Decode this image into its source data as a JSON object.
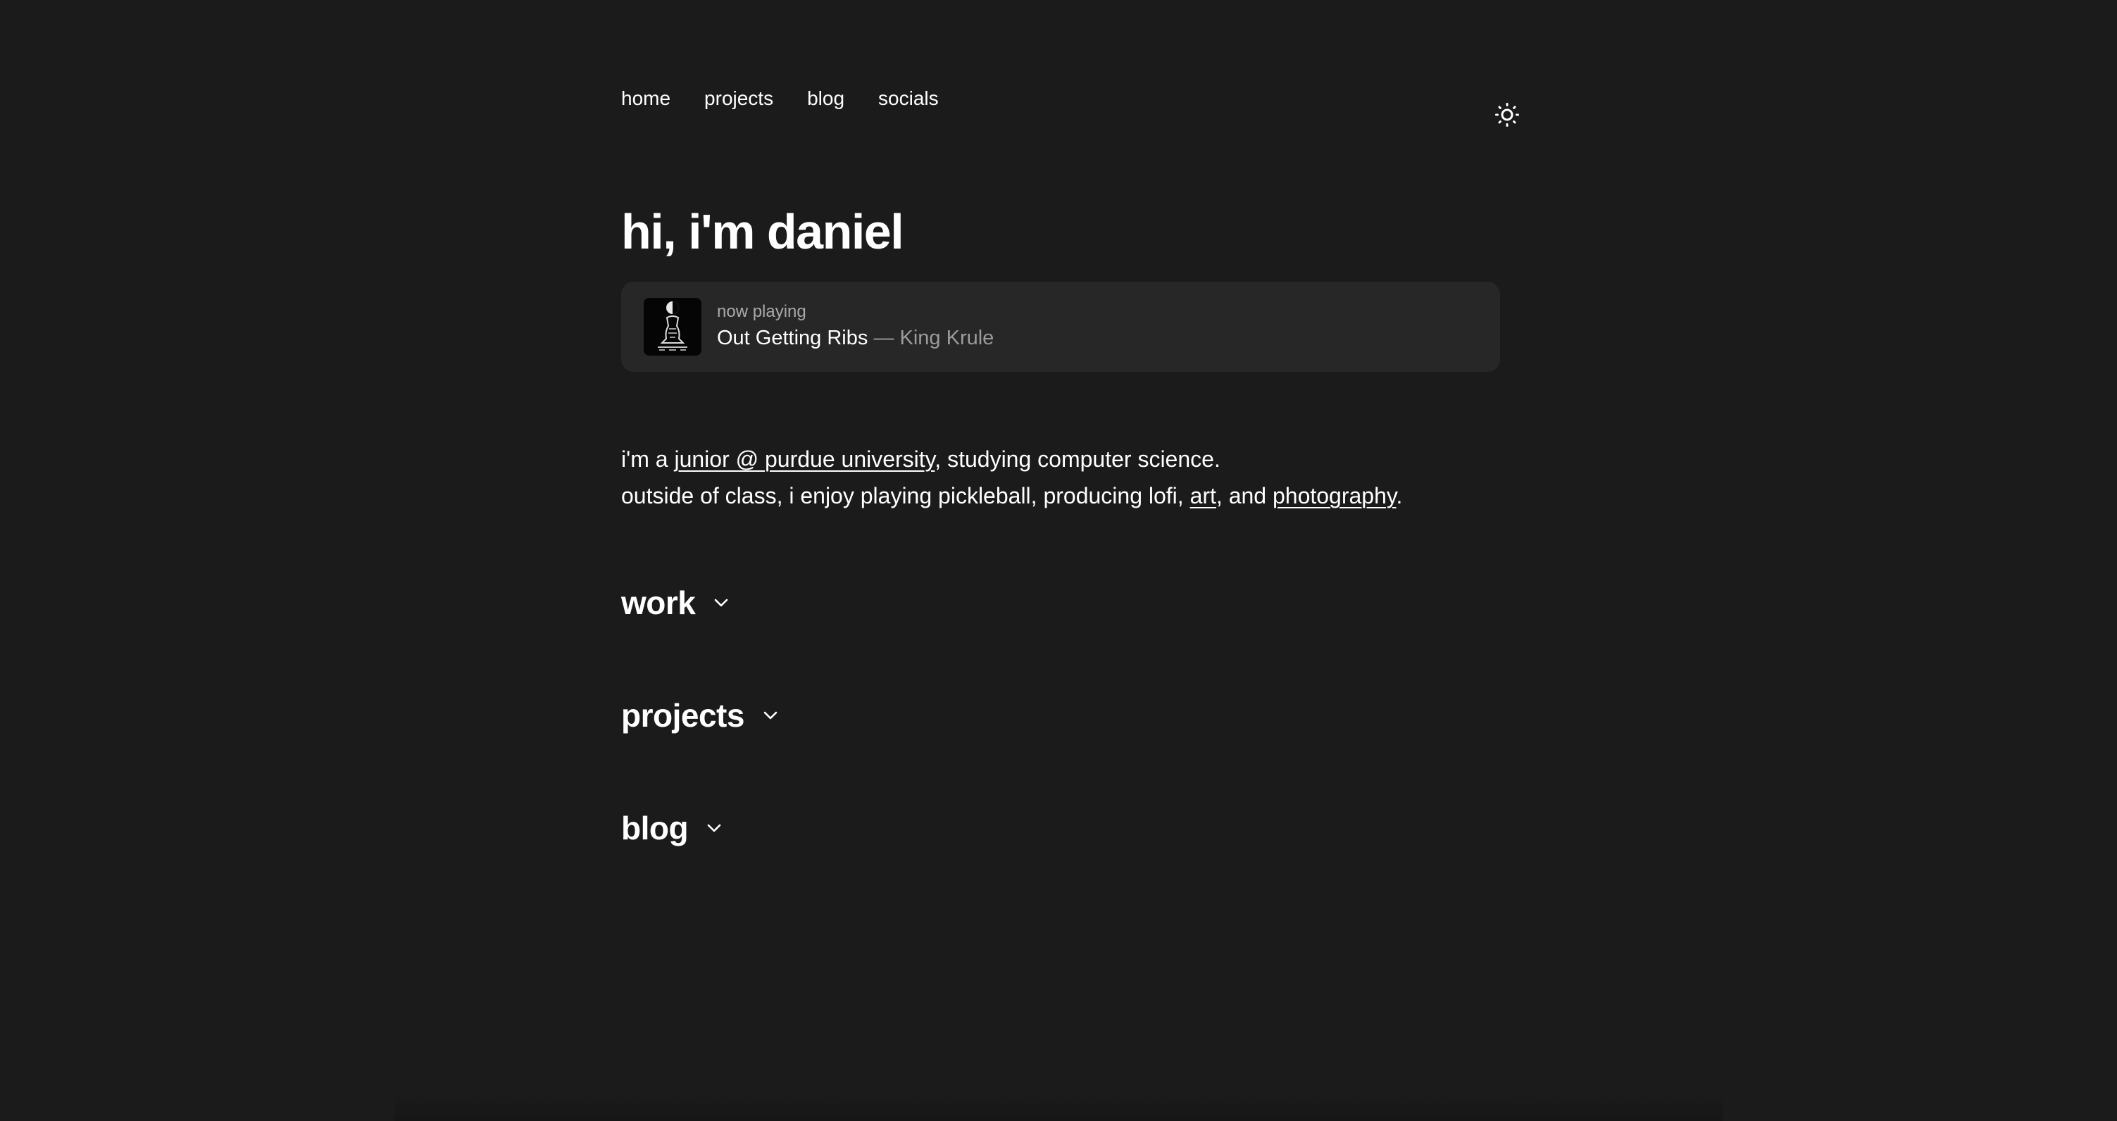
{
  "nav": {
    "items": [
      {
        "label": "home"
      },
      {
        "label": "projects"
      },
      {
        "label": "blog"
      },
      {
        "label": "socials"
      }
    ],
    "theme_toggle_icon": "sun-icon"
  },
  "hero": {
    "title": "hi, i'm daniel"
  },
  "now_playing": {
    "label": "now playing",
    "song": "Out Getting Ribs",
    "separator": "—",
    "artist": "King Krule",
    "art_icon": "album-cover"
  },
  "bio": {
    "line1": {
      "prefix": "i'm a ",
      "link": "junior @ purdue university",
      "suffix": ", studying computer science."
    },
    "line2": {
      "prefix": "outside of class, i enjoy playing pickleball, producing lofi, ",
      "link_art": "art",
      "middle": ", and ",
      "link_photo": "photography",
      "suffix": "."
    }
  },
  "sections": [
    {
      "title": "work",
      "icon": "chevron-down-icon"
    },
    {
      "title": "projects",
      "icon": "chevron-down-icon"
    },
    {
      "title": "blog",
      "icon": "chevron-down-icon"
    }
  ],
  "colors": {
    "background": "#1b1b1b",
    "card": "#272727",
    "text": "#ffffff",
    "muted": "#9b9b9b"
  }
}
